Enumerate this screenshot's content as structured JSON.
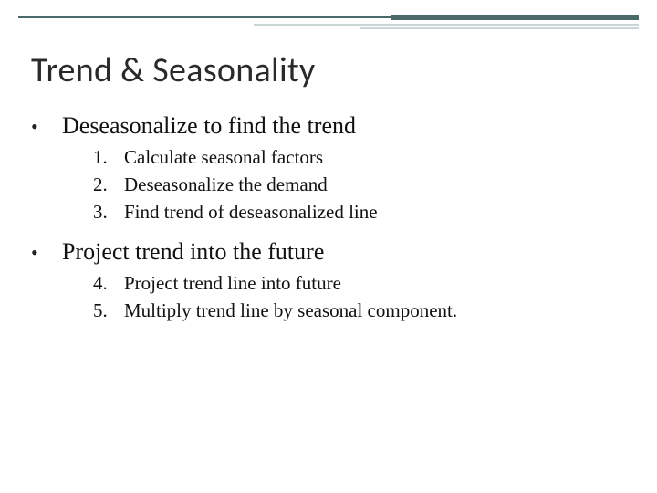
{
  "title": "Trend & Seasonality",
  "bullets": [
    {
      "text": "Deseasonalize to find the trend",
      "items": [
        {
          "n": "1.",
          "text": "Calculate seasonal factors"
        },
        {
          "n": "2.",
          "text": "Deseasonalize the demand"
        },
        {
          "n": "3.",
          "text": "Find trend of deseasonalized line"
        }
      ]
    },
    {
      "text": "Project trend into the future",
      "items": [
        {
          "n": "4.",
          "text": "Project trend line into future"
        },
        {
          "n": "5.",
          "text": "Multiply trend line by seasonal component."
        }
      ]
    }
  ]
}
